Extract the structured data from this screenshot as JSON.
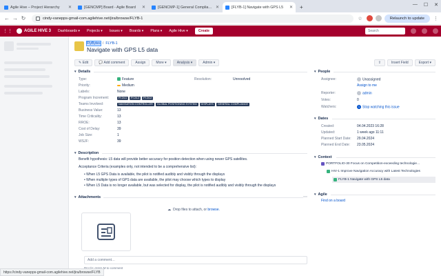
{
  "browser": {
    "tabs": [
      {
        "title": "Agile Hive – Project Hierarchy",
        "active": false
      },
      {
        "title": "[GENCMP] Board - Agile Board",
        "active": false
      },
      {
        "title": "[GENCMP-1] General Compliance",
        "active": false
      },
      {
        "title": "[FLYB-1] Navigate with GPS L5",
        "active": true
      }
    ],
    "url": "cindy-vanepps-gmail-com.agilehive.net/jira/browse/FLYB-1",
    "relaunch_label": "Relaunch to update",
    "status_url": "https://cindy-vanepps-gmail-com.agilehive.net/jira/browse/FLYB"
  },
  "jira_nav": {
    "logo": "AGILE HIVE 3",
    "menus": [
      "Dashboards ▾",
      "Projects ▾",
      "Issues ▾",
      "Boards ▾",
      "Plans ▾",
      "Agile Hive ▾"
    ],
    "create_label": "Create",
    "search_placeholder": "Search"
  },
  "issue": {
    "breadcrumb_project": "FlyBytes",
    "breadcrumb_key": "FLYB-1",
    "title": "Navigate with GPS L5 data",
    "ops": [
      "✎ Edit",
      "💬 Add comment",
      "Assign",
      "More ▾",
      "Analysis ▾",
      "Admin ▾"
    ],
    "ops_right": [
      "⇪",
      "Insert Field",
      "Export ▾"
    ]
  },
  "details": {
    "heading": "Details",
    "rows": [
      {
        "k": "Type:",
        "v": "Feature"
      },
      {
        "k": "Priority:",
        "v": "Medium"
      },
      {
        "k": "Labels:",
        "v": "None"
      },
      {
        "k": "Program Increment:",
        "v": ""
      },
      {
        "k": "Teams Involved:",
        "v": ""
      },
      {
        "k": "Business Value:",
        "v": "13"
      },
      {
        "k": "Time Criticality:",
        "v": "13"
      },
      {
        "k": "RROE:",
        "v": "13"
      },
      {
        "k": "Cost of Delay:",
        "v": "39"
      },
      {
        "k": "Job Size:",
        "v": "1"
      },
      {
        "k": "WSJF:",
        "v": "39"
      }
    ],
    "pi_tags": [
      "PI 24.1",
      "PI 24.2",
      "PI 24.2"
    ],
    "team_tags": [
      "NAVIGATION CONTROLLER",
      "GLOBAL POSITIONING SYSTEM",
      "DISPLAYS",
      "GENERAL COMPLIANCE"
    ],
    "resolution_label": "Resolution:",
    "resolution_value": "Unresolved"
  },
  "description": {
    "heading": "Description",
    "hypothesis": "Benefit hypothesis: L5 data will provide better accuracy for position detection when using newer GPS satellites.",
    "criteria_intro": "Acceptance Criteria (examples only, not intended to be a comprehensive list):",
    "bullets": [
      "When L5 GPS Data is available, the pilot is notified audibly and visibly through the displays",
      "When multiple types of GPS data are available, the pilot may choose which types to display",
      "When L5 Data is no longer available, but was selected for display, the pilot is notified audibly and visibly through the displays"
    ]
  },
  "attachments": {
    "heading": "Attachments",
    "drop_text": "Drop files to attach, or",
    "browse_link": "browse.",
    "comment_placeholder": "Add a comment…",
    "hint": "Pro tip: press M to comment"
  },
  "people": {
    "heading": "People",
    "assignee_label": "Assignee:",
    "assignee_value": "Unassigned",
    "assign_to_me": "Assign to me",
    "reporter_label": "Reporter:",
    "reporter_value": "admin",
    "votes_label": "Votes:",
    "votes_value": "0",
    "watchers_label": "Watchers:",
    "watchers_count": "1",
    "watchers_value": "Stop watching this issue"
  },
  "dates": {
    "heading": "Dates",
    "rows": [
      {
        "k": "Created:",
        "v": "04.04.2023 16:28"
      },
      {
        "k": "Updated:",
        "v": "1 week ago 11:11"
      },
      {
        "k": "Planned Start Date:",
        "v": "29.04.2024"
      },
      {
        "k": "Planned End Date:",
        "v": "23.05.2024"
      }
    ]
  },
  "context": {
    "heading": "Context",
    "items": [
      "PORTFOLIO-30 Focus on Competition-exceeding technologie…",
      "HIV-1 Improve Navigation Accuracy with Latest Technologies",
      "FLYB-1 Navigate with GPS L5 data"
    ]
  },
  "agile": {
    "heading": "Agile",
    "link": "Find on a board"
  },
  "colors": {
    "jira_red": "#a5002d",
    "link_blue": "#0052cc",
    "feature_green": "#36b37e",
    "tag_dark": "#344563"
  }
}
